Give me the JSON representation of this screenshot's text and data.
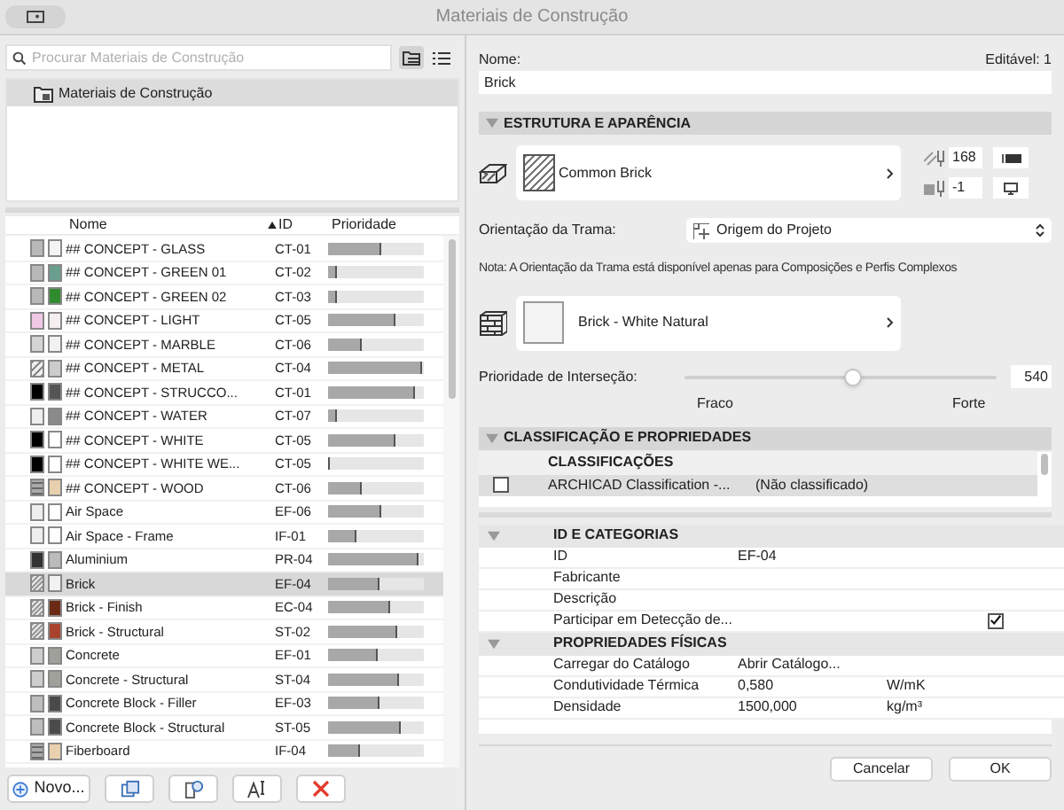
{
  "window": {
    "title": "Materiais de Construção"
  },
  "search": {
    "placeholder": "Procurar Materiais de Construção"
  },
  "folders": [
    {
      "label": "Materiais de Construção",
      "selected": true
    }
  ],
  "table": {
    "columns": [
      "Nome",
      "ID",
      "Prioridade"
    ],
    "rows": [
      {
        "kind": "dots",
        "color": "#f4f4f4",
        "name": "## CONCEPT - GLASS",
        "id": "CT-01",
        "level": 0.55,
        "selected": false
      },
      {
        "kind": "dots",
        "color": "#6a9e8e",
        "name": "## CONCEPT - GREEN 01",
        "id": "CT-02",
        "level": 0.1,
        "selected": false
      },
      {
        "kind": "dots",
        "color": "#2e8b2e",
        "name": "## CONCEPT - GREEN 02",
        "id": "CT-03",
        "level": 0.1,
        "selected": false
      },
      {
        "kind": "tint",
        "color": "#f4eeee",
        "name": "## CONCEPT - LIGHT",
        "id": "CT-05",
        "level": 0.7,
        "selected": false
      },
      {
        "kind": "marble",
        "color": "#f3f0f0",
        "name": "## CONCEPT - MARBLE",
        "id": "CT-06",
        "level": 0.35,
        "selected": false
      },
      {
        "kind": "hatch",
        "color": "#cccccc",
        "name": "## CONCEPT - METAL",
        "id": "CT-04",
        "level": 0.98,
        "selected": false
      },
      {
        "kind": "solid",
        "color": "#555555",
        "name": "## CONCEPT - STRUCCO...",
        "id": "CT-01",
        "level": 0.9,
        "selected": false
      },
      {
        "kind": "plain",
        "color": "#8a8a8a",
        "name": "## CONCEPT - WATER",
        "id": "CT-07",
        "level": 0.1,
        "selected": false
      },
      {
        "kind": "solid",
        "color": "#ffffff",
        "name": "## CONCEPT - WHITE",
        "id": "CT-05",
        "level": 0.7,
        "selected": false
      },
      {
        "kind": "solid",
        "color": "#ffffff",
        "name": "## CONCEPT - WHITE WE...",
        "id": "CT-05",
        "level": 0.02,
        "selected": false
      },
      {
        "kind": "lines",
        "color": "#e8cfae",
        "name": "## CONCEPT - WOOD",
        "id": "CT-06",
        "level": 0.35,
        "selected": false
      },
      {
        "kind": "plain",
        "color": "#ffffff",
        "name": "Air Space",
        "id": "EF-06",
        "level": 0.56,
        "selected": false
      },
      {
        "kind": "plain",
        "color": "#fefefe",
        "name": "Air Space - Frame",
        "id": "IF-01",
        "level": 0.3,
        "selected": false
      },
      {
        "kind": "dark",
        "color": "#bbbbbb",
        "name": "Aluminium",
        "id": "PR-04",
        "level": 0.95,
        "selected": false
      },
      {
        "kind": "brick",
        "color": "#f2f2f2",
        "name": "Brick",
        "id": "EF-04",
        "level": 0.54,
        "selected": true
      },
      {
        "kind": "brick",
        "color": "#6b2a16",
        "name": "Brick - Finish",
        "id": "EC-04",
        "level": 0.64,
        "selected": false
      },
      {
        "kind": "brick",
        "color": "#a8432e",
        "name": "Brick - Structural",
        "id": "ST-02",
        "level": 0.72,
        "selected": false
      },
      {
        "kind": "concrete",
        "color": "#a0a09a",
        "name": "Concrete",
        "id": "EF-01",
        "level": 0.52,
        "selected": false
      },
      {
        "kind": "concrete",
        "color": "#a1a19b",
        "name": "Concrete - Structural",
        "id": "ST-04",
        "level": 0.74,
        "selected": false
      },
      {
        "kind": "block",
        "color": "#4a4a4a",
        "name": "Concrete Block - Filler",
        "id": "EF-03",
        "level": 0.53,
        "selected": false
      },
      {
        "kind": "block",
        "color": "#4b4b4b",
        "name": "Concrete Block - Structural",
        "id": "ST-05",
        "level": 0.76,
        "selected": false
      },
      {
        "kind": "lines",
        "color": "#e9d0af",
        "name": "Fiberboard",
        "id": "IF-04",
        "level": 0.34,
        "selected": false
      }
    ]
  },
  "left_buttons": [
    {
      "kind": "new",
      "label": "Novo..."
    },
    {
      "kind": "duplicate"
    },
    {
      "kind": "import"
    },
    {
      "kind": "rename"
    },
    {
      "kind": "delete"
    }
  ],
  "details": {
    "name_label": "Nome:",
    "editable": "Editável: 1",
    "name_value": "Brick",
    "structure": {
      "title": "ESTRUTURA E APARÊNCIA",
      "expanded": true,
      "fill_name": "Common Brick",
      "pen_fill": "168",
      "pen_background": "-1",
      "orientation_label": "Orientação da Trama:",
      "orientation_value": "Origem do Projeto",
      "note": "Nota: A Orientação da Trama está disponível apenas para Composições e Perfis Complexos",
      "surface_name": "Brick - White Natural",
      "priority_label": "Prioridade de Interseção:",
      "priority": {
        "level": 0.54,
        "reading": "540"
      },
      "min_label": "Fraco",
      "max_label": "Forte"
    },
    "classification": {
      "title": "CLASSIFICAÇÃO E PROPRIEDADES",
      "expanded": true,
      "list_header": "CLASSIFICAÇÕES",
      "items": [
        {
          "system": "ARCHICAD Classification -...",
          "value": "(Não classificado)",
          "checked": false,
          "selected": true
        }
      ]
    },
    "properties": {
      "groups": [
        {
          "title": "ID E CATEGORIAS",
          "expanded": true,
          "rows": [
            {
              "kind": "text",
              "name": "ID",
              "value": "EF-04"
            },
            {
              "kind": "text",
              "name": "Fabricante"
            },
            {
              "kind": "text",
              "name": "Descrição"
            },
            {
              "kind": "checkbox",
              "name": "Participar em Detecção de...",
              "checked": true
            }
          ]
        },
        {
          "title": "PROPRIEDADES FÍSICAS",
          "expanded": true,
          "rows": [
            {
              "kind": "text",
              "name": "Carregar do Catálogo",
              "value": "Abrir Catálogo..."
            },
            {
              "kind": "text",
              "name": "Condutividade Térmica",
              "value": "0,580",
              "unit": "W/mK"
            },
            {
              "kind": "text",
              "name": "Densidade",
              "value": "1500,000",
              "unit": "kg/m³"
            }
          ]
        }
      ]
    }
  },
  "buttons": [
    "Cancelar",
    "OK"
  ]
}
